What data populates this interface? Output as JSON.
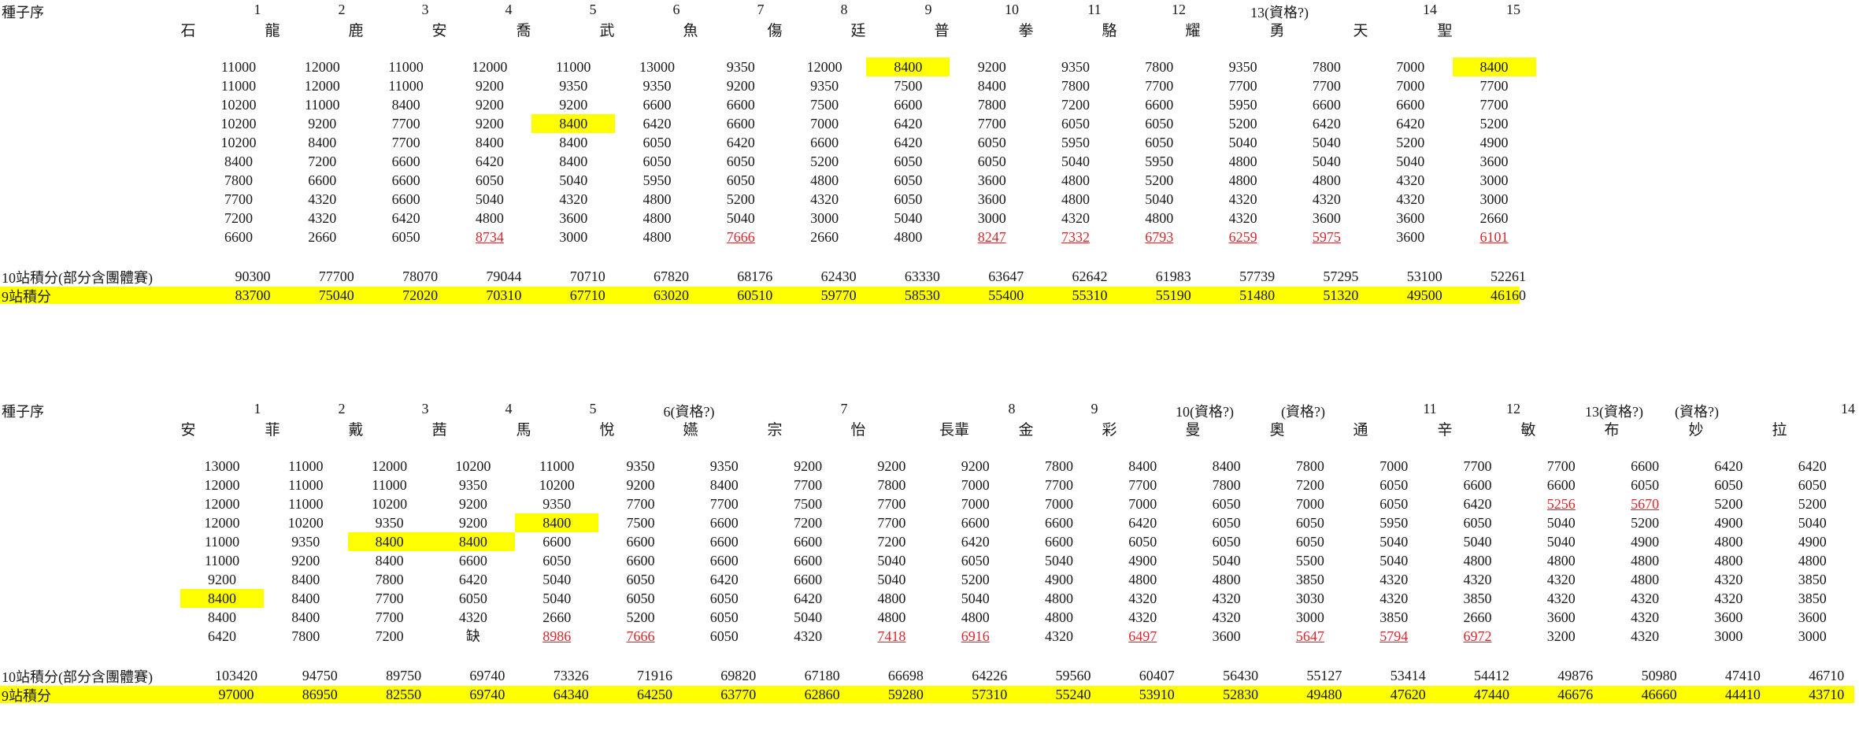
{
  "block1": {
    "seed_label": "種子序",
    "seeds": [
      "1",
      "2",
      "3",
      "4",
      "5",
      "6",
      "7",
      "8",
      "9",
      "10",
      "11",
      "12",
      "13(資格?)",
      "14",
      "15"
    ],
    "names": [
      "石",
      "龍",
      "鹿",
      "安",
      "喬",
      "武",
      "魚",
      "傷",
      "廷",
      "普",
      "拳",
      "駱",
      "耀",
      "勇",
      "天",
      "聖"
    ],
    "scores": [
      [
        "11000",
        "12000",
        "11000",
        "12000",
        "11000",
        "13000",
        "9350",
        "12000",
        "8400",
        "9200",
        "9350",
        "7800",
        "9350",
        "7800",
        "7000",
        "8400"
      ],
      [
        "11000",
        "12000",
        "11000",
        "9200",
        "9350",
        "9350",
        "9200",
        "9350",
        "7500",
        "8400",
        "7800",
        "7700",
        "7700",
        "7700",
        "7000",
        "7700"
      ],
      [
        "10200",
        "11000",
        "8400",
        "9200",
        "9200",
        "6600",
        "6600",
        "7500",
        "6600",
        "7800",
        "7200",
        "6600",
        "5950",
        "6600",
        "6600",
        "7700"
      ],
      [
        "10200",
        "9200",
        "7700",
        "9200",
        "8400",
        "6420",
        "6600",
        "7000",
        "6420",
        "7700",
        "6050",
        "6050",
        "5200",
        "6420",
        "6420",
        "5200"
      ],
      [
        "10200",
        "8400",
        "7700",
        "8400",
        "8400",
        "6050",
        "6420",
        "6600",
        "6420",
        "6050",
        "5950",
        "6050",
        "5040",
        "5040",
        "5200",
        "4900"
      ],
      [
        "8400",
        "7200",
        "6600",
        "6420",
        "8400",
        "6050",
        "6050",
        "5200",
        "6050",
        "6050",
        "5040",
        "5950",
        "4800",
        "5040",
        "5040",
        "3600"
      ],
      [
        "7800",
        "6600",
        "6600",
        "6050",
        "5040",
        "5950",
        "6050",
        "4800",
        "6050",
        "3600",
        "4800",
        "5200",
        "4800",
        "4800",
        "4320",
        "3000"
      ],
      [
        "7700",
        "4320",
        "6600",
        "5040",
        "4320",
        "4800",
        "5200",
        "4320",
        "6050",
        "3600",
        "4800",
        "5040",
        "4320",
        "4320",
        "4320",
        "3000"
      ],
      [
        "7200",
        "4320",
        "6420",
        "4800",
        "3600",
        "4800",
        "5040",
        "3000",
        "5040",
        "3000",
        "4320",
        "4800",
        "4320",
        "3600",
        "3600",
        "2660"
      ],
      [
        "6600",
        "2660",
        "6050",
        "8734",
        "3000",
        "4800",
        "7666",
        "2660",
        "4800",
        "8247",
        "7332",
        "6793",
        "6259",
        "5975",
        "3600",
        "6101"
      ]
    ],
    "yellow_cells": [
      [
        0,
        8
      ],
      [
        0,
        15
      ],
      [
        3,
        4
      ]
    ],
    "red_cells": [
      [
        9,
        3
      ],
      [
        9,
        6
      ],
      [
        9,
        9
      ],
      [
        9,
        10
      ],
      [
        9,
        11
      ],
      [
        9,
        12
      ],
      [
        9,
        13
      ],
      [
        9,
        15
      ]
    ],
    "total10_label": "10站積分(部分含團體賽)",
    "total10": [
      "90300",
      "77700",
      "78070",
      "79044",
      "70710",
      "67820",
      "68176",
      "62430",
      "63330",
      "63647",
      "62642",
      "61983",
      "57739",
      "57295",
      "53100",
      "52261"
    ],
    "total9_label": "9站積分",
    "total9": [
      "83700",
      "75040",
      "72020",
      "70310",
      "67710",
      "63020",
      "60510",
      "59770",
      "58530",
      "55400",
      "55310",
      "55190",
      "51480",
      "51320",
      "49500",
      "46160"
    ]
  },
  "block2": {
    "seed_label": "種子序",
    "seeds": [
      "1",
      "2",
      "3",
      "4",
      "5",
      "6(資格?)",
      "7",
      "8",
      "9",
      "10(資格?)",
      "(資格?)",
      "11",
      "12",
      "13(資格?)",
      "(資格?)",
      "14"
    ],
    "names": [
      "安",
      "菲",
      "戴",
      "茜",
      "馬",
      "悅",
      "嬿",
      "宗",
      "怡",
      "長輩",
      "金",
      "彩",
      "曼",
      "奧",
      "通",
      "辛",
      "敏",
      "布",
      "妙",
      "拉"
    ],
    "scores": [
      [
        "13000",
        "11000",
        "12000",
        "10200",
        "11000",
        "9350",
        "9350",
        "9200",
        "9200",
        "9200",
        "7800",
        "8400",
        "8400",
        "7800",
        "7000",
        "7700",
        "7700",
        "6600",
        "6420",
        "6420"
      ],
      [
        "12000",
        "11000",
        "11000",
        "9350",
        "10200",
        "9200",
        "8400",
        "7700",
        "7800",
        "7000",
        "7700",
        "7700",
        "7800",
        "7200",
        "6050",
        "6600",
        "6600",
        "6050",
        "6050",
        "6050"
      ],
      [
        "12000",
        "11000",
        "10200",
        "9200",
        "9350",
        "7700",
        "7700",
        "7500",
        "7700",
        "7000",
        "7000",
        "7000",
        "6050",
        "7000",
        "6050",
        "6420",
        "5256",
        "5670",
        "5200",
        "5200"
      ],
      [
        "12000",
        "10200",
        "9350",
        "9200",
        "8400",
        "7500",
        "6600",
        "7200",
        "7700",
        "6600",
        "6600",
        "6420",
        "6050",
        "6050",
        "5950",
        "6050",
        "5040",
        "5200",
        "4900",
        "5040"
      ],
      [
        "11000",
        "9350",
        "8400",
        "8400",
        "6600",
        "6600",
        "6600",
        "6600",
        "7200",
        "6420",
        "6600",
        "6050",
        "6050",
        "6050",
        "5040",
        "5040",
        "5040",
        "4900",
        "4800",
        "4900"
      ],
      [
        "11000",
        "9200",
        "8400",
        "6600",
        "6050",
        "6600",
        "6600",
        "6600",
        "5040",
        "6050",
        "5040",
        "4900",
        "5040",
        "5500",
        "5040",
        "4800",
        "4800",
        "4800",
        "4800",
        "4800"
      ],
      [
        "9200",
        "8400",
        "7800",
        "6420",
        "5040",
        "6050",
        "6420",
        "6600",
        "5040",
        "5200",
        "4900",
        "4800",
        "4800",
        "3850",
        "4320",
        "4320",
        "4320",
        "4800",
        "4320",
        "3850"
      ],
      [
        "8400",
        "8400",
        "7700",
        "6050",
        "5040",
        "6050",
        "6050",
        "6420",
        "4800",
        "5040",
        "4800",
        "4320",
        "4320",
        "3030",
        "4320",
        "3850",
        "4320",
        "4320",
        "4320",
        "3850"
      ],
      [
        "8400",
        "8400",
        "7700",
        "4320",
        "2660",
        "5200",
        "6050",
        "5040",
        "4800",
        "4800",
        "4800",
        "4320",
        "4320",
        "3000",
        "3850",
        "2660",
        "3600",
        "4320",
        "3600",
        "3600"
      ],
      [
        "6420",
        "7800",
        "7200",
        "缺",
        "8986",
        "7666",
        "6050",
        "4320",
        "7418",
        "6916",
        "4320",
        "6497",
        "3600",
        "5647",
        "5794",
        "6972",
        "3200",
        "4320",
        "3000",
        "3000"
      ]
    ],
    "yellow_cells": [
      [
        7,
        0
      ],
      [
        4,
        2
      ],
      [
        4,
        3
      ],
      [
        3,
        4
      ]
    ],
    "red_cells": [
      [
        9,
        4
      ],
      [
        9,
        5
      ],
      [
        9,
        8
      ],
      [
        9,
        9
      ],
      [
        9,
        11
      ],
      [
        9,
        13
      ],
      [
        9,
        14
      ],
      [
        9,
        15
      ],
      [
        2,
        16
      ],
      [
        2,
        17
      ]
    ],
    "total10_label": "10站積分(部分含團體賽)",
    "total10": [
      "103420",
      "94750",
      "89750",
      "69740",
      "73326",
      "71916",
      "69820",
      "67180",
      "66698",
      "64226",
      "59560",
      "60407",
      "56430",
      "55127",
      "53414",
      "54412",
      "49876",
      "50980",
      "47410",
      "46710"
    ],
    "total9_label": "9站積分",
    "total9": [
      "97000",
      "86950",
      "82550",
      "69740",
      "64340",
      "64250",
      "63770",
      "62860",
      "59280",
      "57310",
      "55240",
      "53910",
      "52830",
      "49480",
      "47620",
      "47440",
      "46676",
      "46660",
      "44410",
      "43710"
    ]
  }
}
